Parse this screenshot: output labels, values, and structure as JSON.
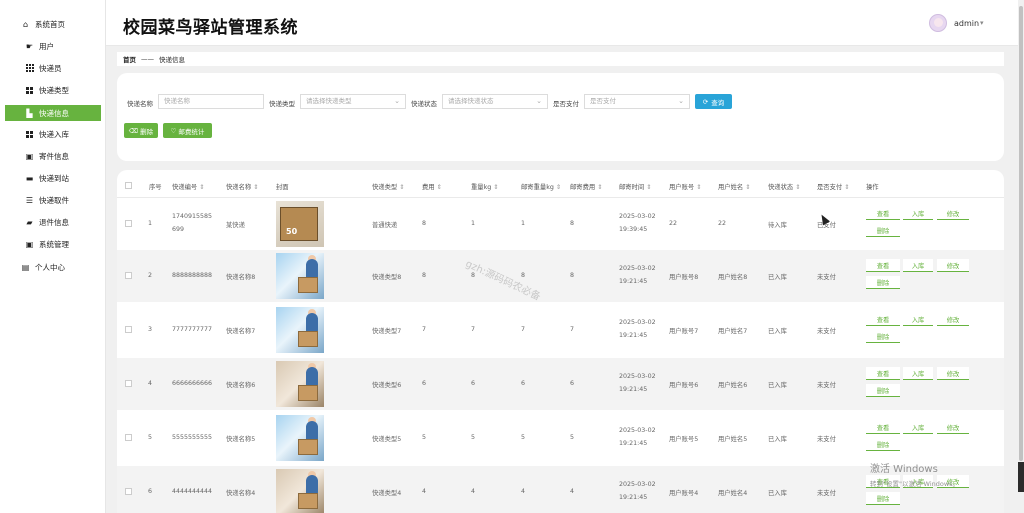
{
  "app": {
    "title": "校园菜鸟驿站管理系统",
    "user": "admin",
    "caret": "▾"
  },
  "sidebar": {
    "home": "系统首页",
    "items": [
      "用户",
      "快递员",
      "快递类型",
      "快递信息",
      "快递入库",
      "寄件信息",
      "快递到站",
      "快递取件",
      "退件信息",
      "系统管理"
    ],
    "active": "快递信息",
    "personal": "个人中心"
  },
  "breadcrumb": {
    "home": "首页",
    "sep": "——",
    "current": "快递信息"
  },
  "search": {
    "fields": [
      {
        "label": "快递名称",
        "placeholder": "快递名称",
        "type": "input"
      },
      {
        "label": "快递类型",
        "placeholder": "请选择快递类型",
        "type": "select"
      },
      {
        "label": "快递状态",
        "placeholder": "请选择快递状态",
        "type": "select"
      },
      {
        "label": "是否支付",
        "placeholder": "是否支付",
        "type": "select"
      }
    ],
    "query_label": "查询",
    "delete_label": "删除",
    "stats_label": "邮费统计"
  },
  "table": {
    "headers": [
      "序号",
      "快递编号",
      "快递名称",
      "封面",
      "快递类型",
      "费用",
      "重量kg",
      "邮寄重量kg",
      "邮寄费用",
      "邮寄时间",
      "用户账号",
      "用户姓名",
      "快递状态",
      "是否支付",
      "操作"
    ],
    "sort_glyph": "⇕",
    "rows": [
      {
        "index": "1",
        "code": "1740915585699",
        "code_l1": "1740915585",
        "code_l2": "699",
        "name": "某快递",
        "type": "普通快递",
        "fee": "8",
        "weight": "1",
        "post_weight": "1",
        "post_fee": "8",
        "date": "2025-03-02",
        "time": "19:39:45",
        "account": "22",
        "username": "22",
        "status": "待入库",
        "paid": "已支付"
      },
      {
        "index": "2",
        "code": "8888888888",
        "code_l1": "8888888888",
        "code_l2": "",
        "name": "快递名称8",
        "type": "快递类型8",
        "fee": "8",
        "weight": "8",
        "post_weight": "8",
        "post_fee": "8",
        "date": "2025-03-02",
        "time": "19:21:45",
        "account": "用户账号8",
        "username": "用户姓名8",
        "status": "已入库",
        "paid": "未支付"
      },
      {
        "index": "3",
        "code": "7777777777",
        "code_l1": "7777777777",
        "code_l2": "",
        "name": "快递名称7",
        "type": "快递类型7",
        "fee": "7",
        "weight": "7",
        "post_weight": "7",
        "post_fee": "7",
        "date": "2025-03-02",
        "time": "19:21:45",
        "account": "用户账号7",
        "username": "用户姓名7",
        "status": "已入库",
        "paid": "未支付"
      },
      {
        "index": "4",
        "code": "6666666666",
        "code_l1": "6666666666",
        "code_l2": "",
        "name": "快递名称6",
        "type": "快递类型6",
        "fee": "6",
        "weight": "6",
        "post_weight": "6",
        "post_fee": "6",
        "date": "2025-03-02",
        "time": "19:21:45",
        "account": "用户账号6",
        "username": "用户姓名6",
        "status": "已入库",
        "paid": "未支付"
      },
      {
        "index": "5",
        "code": "5555555555",
        "code_l1": "5555555555",
        "code_l2": "",
        "name": "快递名称5",
        "type": "快递类型5",
        "fee": "5",
        "weight": "5",
        "post_weight": "5",
        "post_fee": "5",
        "date": "2025-03-02",
        "time": "19:21:45",
        "account": "用户账号5",
        "username": "用户姓名5",
        "status": "已入库",
        "paid": "未支付"
      },
      {
        "index": "6",
        "code": "4444444444",
        "code_l1": "4444444444",
        "code_l2": "",
        "name": "快递名称4",
        "type": "快递类型4",
        "fee": "4",
        "weight": "4",
        "post_weight": "4",
        "post_fee": "4",
        "date": "2025-03-02",
        "time": "19:21:45",
        "account": "用户账号4",
        "username": "用户姓名4",
        "status": "已入库",
        "paid": "未支付"
      }
    ],
    "actions": {
      "view": "查看",
      "stockin": "入库",
      "edit": "修改",
      "delete": "删除"
    }
  },
  "overlay": {
    "watermark": "gzh:源码码农必备",
    "activate_title": "激活 Windows",
    "activate_sub": "转到\"设置\"以激活 Windows。"
  },
  "colors": {
    "accent": "#67b33f",
    "query": "#29a4d8"
  }
}
